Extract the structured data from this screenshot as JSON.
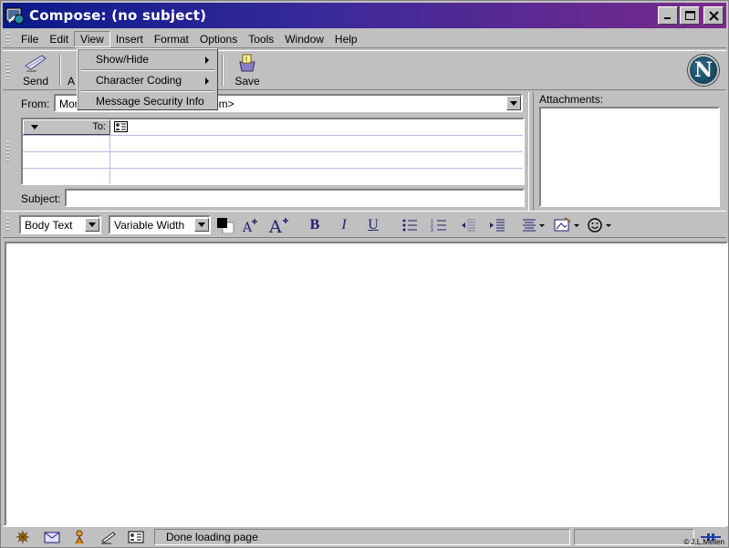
{
  "window": {
    "title": "Compose: (no subject)"
  },
  "menubar": {
    "items": [
      {
        "label": "File"
      },
      {
        "label": "Edit"
      },
      {
        "label": "View"
      },
      {
        "label": "Insert"
      },
      {
        "label": "Format"
      },
      {
        "label": "Options"
      },
      {
        "label": "Tools"
      },
      {
        "label": "Window"
      },
      {
        "label": "Help"
      }
    ]
  },
  "view_menu": {
    "items": [
      {
        "label": "Show/Hide",
        "submenu": true
      },
      {
        "label": "Character Coding",
        "submenu": true
      },
      {
        "label": "Message Security Info",
        "submenu": false
      }
    ]
  },
  "toolbar": {
    "send_label": "Send",
    "partial_label": "A",
    "save_label": "Save"
  },
  "address": {
    "from_label": "From:",
    "from_value_left": "Mon",
    "from_value_right": "om>",
    "to_label": "To:",
    "subject_label": "Subject:",
    "subject_value": ""
  },
  "attachments": {
    "label": "Attachments:"
  },
  "format": {
    "style_value": "Body Text",
    "font_value": "Variable Width",
    "bold": "B",
    "italic": "I",
    "underline": "U"
  },
  "status": {
    "text": "Done loading page",
    "credit": "© J.L.Mellen"
  },
  "colors": {
    "title_start": "#0a1a8a",
    "title_end": "#7a2a8a",
    "chrome": "#c0c0c0"
  }
}
